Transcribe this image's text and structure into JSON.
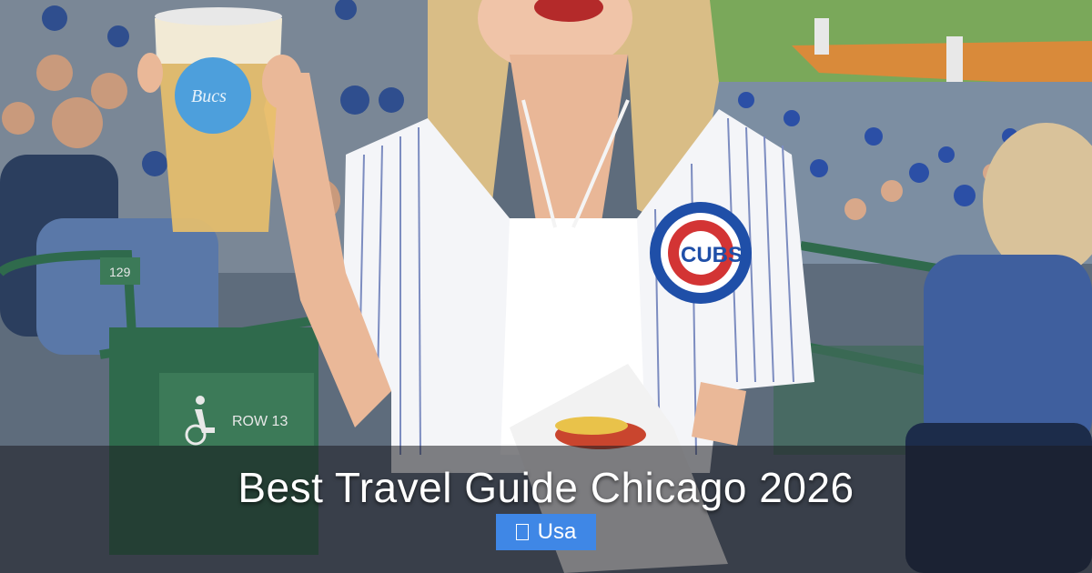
{
  "headline": "Best Travel Guide Chicago 2026",
  "tag": {
    "label": "Usa",
    "icon": "tag-icon"
  },
  "photo": {
    "cup_logo_text": "Bucs",
    "jersey_logo_text": "CUBS",
    "seat_number": "129",
    "row_label": "ROW 13"
  },
  "colors": {
    "tag_bg": "#3f87e6",
    "overlay": "rgba(28,28,32,0.55)",
    "cubs_blue": "#1f4fa8",
    "cubs_red": "#d33434"
  }
}
